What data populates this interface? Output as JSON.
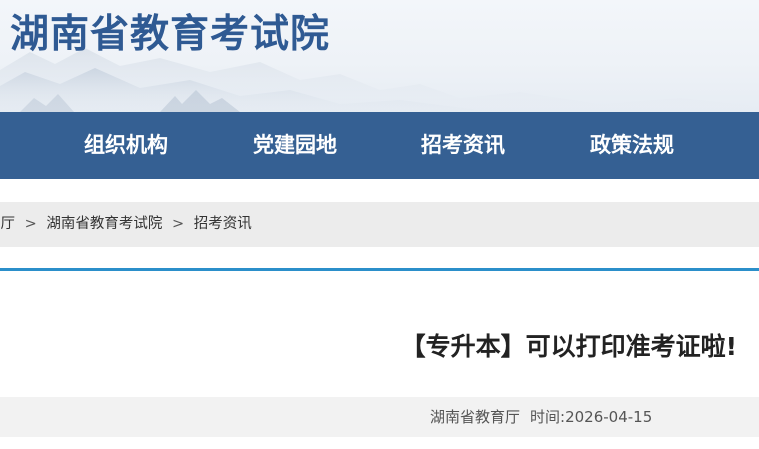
{
  "header": {
    "site_title": "湖南省教育考试院"
  },
  "nav": {
    "items": [
      {
        "label": "组织机构"
      },
      {
        "label": "党建园地"
      },
      {
        "label": "招考资讯"
      },
      {
        "label": "政策法规"
      }
    ],
    "background_color": "#356093"
  },
  "breadcrumb": {
    "items": [
      {
        "label": "育厅"
      },
      {
        "label": "湖南省教育考试院"
      },
      {
        "label": "招考资讯"
      }
    ],
    "separator": ">"
  },
  "article": {
    "title": "【专升本】可以打印准考证啦!",
    "source": "湖南省教育厅",
    "time_label": "时间:",
    "date": "2026-04-15"
  },
  "colors": {
    "accent_rule": "#2b8fca",
    "title_color": "#2f5a93"
  }
}
